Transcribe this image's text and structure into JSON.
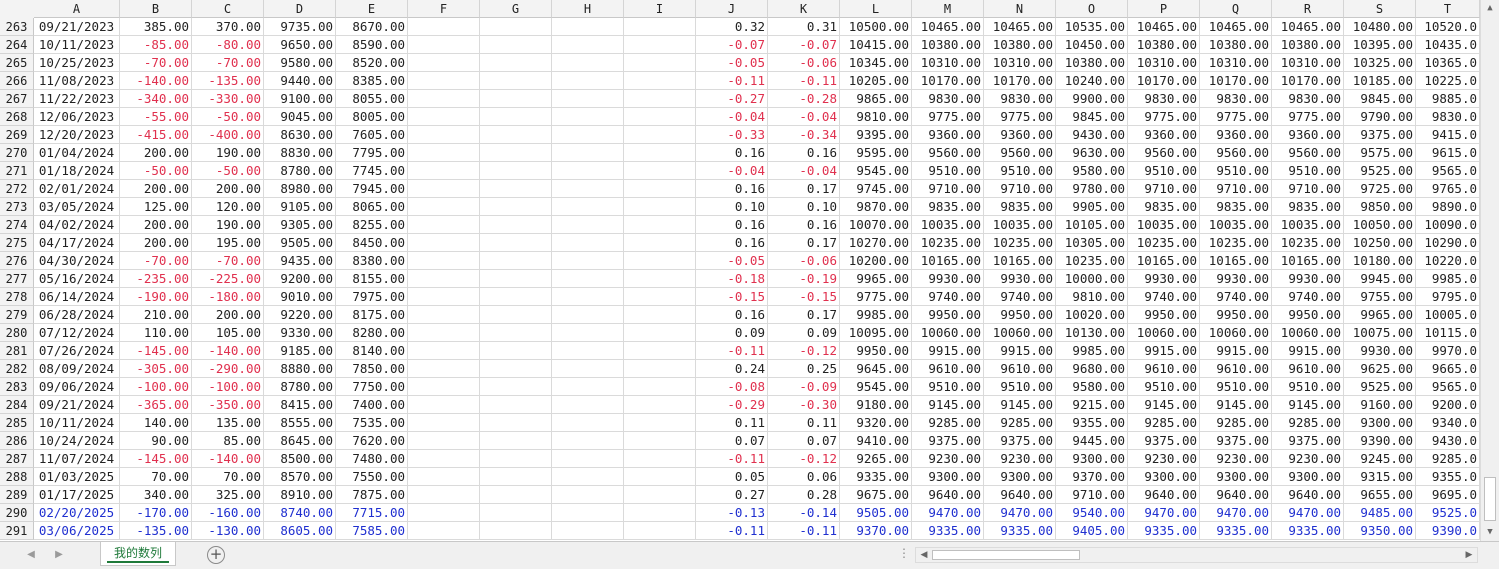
{
  "columns": [
    "A",
    "B",
    "C",
    "D",
    "E",
    "F",
    "G",
    "H",
    "I",
    "J",
    "K",
    "L",
    "M",
    "N",
    "O",
    "P",
    "Q",
    "R",
    "S",
    "T"
  ],
  "rows": [
    {
      "n": "263",
      "c": [
        "09/21/2023",
        "385.00",
        "370.00",
        "9735.00",
        "8670.00",
        "",
        "",
        "",
        "",
        "0.32",
        "0.31",
        "10500.00",
        "10465.00",
        "10465.00",
        "10535.00",
        "10465.00",
        "10465.00",
        "10465.00",
        "10480.00",
        "10520.0"
      ]
    },
    {
      "n": "264",
      "c": [
        "10/11/2023",
        "-85.00",
        "-80.00",
        "9650.00",
        "8590.00",
        "",
        "",
        "",
        "",
        "-0.07",
        "-0.07",
        "10415.00",
        "10380.00",
        "10380.00",
        "10450.00",
        "10380.00",
        "10380.00",
        "10380.00",
        "10395.00",
        "10435.0"
      ]
    },
    {
      "n": "265",
      "c": [
        "10/25/2023",
        "-70.00",
        "-70.00",
        "9580.00",
        "8520.00",
        "",
        "",
        "",
        "",
        "-0.05",
        "-0.06",
        "10345.00",
        "10310.00",
        "10310.00",
        "10380.00",
        "10310.00",
        "10310.00",
        "10310.00",
        "10325.00",
        "10365.0"
      ]
    },
    {
      "n": "266",
      "c": [
        "11/08/2023",
        "-140.00",
        "-135.00",
        "9440.00",
        "8385.00",
        "",
        "",
        "",
        "",
        "-0.11",
        "-0.11",
        "10205.00",
        "10170.00",
        "10170.00",
        "10240.00",
        "10170.00",
        "10170.00",
        "10170.00",
        "10185.00",
        "10225.0"
      ]
    },
    {
      "n": "267",
      "c": [
        "11/22/2023",
        "-340.00",
        "-330.00",
        "9100.00",
        "8055.00",
        "",
        "",
        "",
        "",
        "-0.27",
        "-0.28",
        "9865.00",
        "9830.00",
        "9830.00",
        "9900.00",
        "9830.00",
        "9830.00",
        "9830.00",
        "9845.00",
        "9885.0"
      ]
    },
    {
      "n": "268",
      "c": [
        "12/06/2023",
        "-55.00",
        "-50.00",
        "9045.00",
        "8005.00",
        "",
        "",
        "",
        "",
        "-0.04",
        "-0.04",
        "9810.00",
        "9775.00",
        "9775.00",
        "9845.00",
        "9775.00",
        "9775.00",
        "9775.00",
        "9790.00",
        "9830.0"
      ]
    },
    {
      "n": "269",
      "c": [
        "12/20/2023",
        "-415.00",
        "-400.00",
        "8630.00",
        "7605.00",
        "",
        "",
        "",
        "",
        "-0.33",
        "-0.34",
        "9395.00",
        "9360.00",
        "9360.00",
        "9430.00",
        "9360.00",
        "9360.00",
        "9360.00",
        "9375.00",
        "9415.0"
      ]
    },
    {
      "n": "270",
      "c": [
        "01/04/2024",
        "200.00",
        "190.00",
        "8830.00",
        "7795.00",
        "",
        "",
        "",
        "",
        "0.16",
        "0.16",
        "9595.00",
        "9560.00",
        "9560.00",
        "9630.00",
        "9560.00",
        "9560.00",
        "9560.00",
        "9575.00",
        "9615.0"
      ]
    },
    {
      "n": "271",
      "c": [
        "01/18/2024",
        "-50.00",
        "-50.00",
        "8780.00",
        "7745.00",
        "",
        "",
        "",
        "",
        "-0.04",
        "-0.04",
        "9545.00",
        "9510.00",
        "9510.00",
        "9580.00",
        "9510.00",
        "9510.00",
        "9510.00",
        "9525.00",
        "9565.0"
      ]
    },
    {
      "n": "272",
      "c": [
        "02/01/2024",
        "200.00",
        "200.00",
        "8980.00",
        "7945.00",
        "",
        "",
        "",
        "",
        "0.16",
        "0.17",
        "9745.00",
        "9710.00",
        "9710.00",
        "9780.00",
        "9710.00",
        "9710.00",
        "9710.00",
        "9725.00",
        "9765.0"
      ]
    },
    {
      "n": "273",
      "c": [
        "03/05/2024",
        "125.00",
        "120.00",
        "9105.00",
        "8065.00",
        "",
        "",
        "",
        "",
        "0.10",
        "0.10",
        "9870.00",
        "9835.00",
        "9835.00",
        "9905.00",
        "9835.00",
        "9835.00",
        "9835.00",
        "9850.00",
        "9890.0"
      ]
    },
    {
      "n": "274",
      "c": [
        "04/02/2024",
        "200.00",
        "190.00",
        "9305.00",
        "8255.00",
        "",
        "",
        "",
        "",
        "0.16",
        "0.16",
        "10070.00",
        "10035.00",
        "10035.00",
        "10105.00",
        "10035.00",
        "10035.00",
        "10035.00",
        "10050.00",
        "10090.0"
      ]
    },
    {
      "n": "275",
      "c": [
        "04/17/2024",
        "200.00",
        "195.00",
        "9505.00",
        "8450.00",
        "",
        "",
        "",
        "",
        "0.16",
        "0.17",
        "10270.00",
        "10235.00",
        "10235.00",
        "10305.00",
        "10235.00",
        "10235.00",
        "10235.00",
        "10250.00",
        "10290.0"
      ]
    },
    {
      "n": "276",
      "c": [
        "04/30/2024",
        "-70.00",
        "-70.00",
        "9435.00",
        "8380.00",
        "",
        "",
        "",
        "",
        "-0.05",
        "-0.06",
        "10200.00",
        "10165.00",
        "10165.00",
        "10235.00",
        "10165.00",
        "10165.00",
        "10165.00",
        "10180.00",
        "10220.0"
      ]
    },
    {
      "n": "277",
      "c": [
        "05/16/2024",
        "-235.00",
        "-225.00",
        "9200.00",
        "8155.00",
        "",
        "",
        "",
        "",
        "-0.18",
        "-0.19",
        "9965.00",
        "9930.00",
        "9930.00",
        "10000.00",
        "9930.00",
        "9930.00",
        "9930.00",
        "9945.00",
        "9985.0"
      ]
    },
    {
      "n": "278",
      "c": [
        "06/14/2024",
        "-190.00",
        "-180.00",
        "9010.00",
        "7975.00",
        "",
        "",
        "",
        "",
        "-0.15",
        "-0.15",
        "9775.00",
        "9740.00",
        "9740.00",
        "9810.00",
        "9740.00",
        "9740.00",
        "9740.00",
        "9755.00",
        "9795.0"
      ]
    },
    {
      "n": "279",
      "c": [
        "06/28/2024",
        "210.00",
        "200.00",
        "9220.00",
        "8175.00",
        "",
        "",
        "",
        "",
        "0.16",
        "0.17",
        "9985.00",
        "9950.00",
        "9950.00",
        "10020.00",
        "9950.00",
        "9950.00",
        "9950.00",
        "9965.00",
        "10005.0"
      ]
    },
    {
      "n": "280",
      "c": [
        "07/12/2024",
        "110.00",
        "105.00",
        "9330.00",
        "8280.00",
        "",
        "",
        "",
        "",
        "0.09",
        "0.09",
        "10095.00",
        "10060.00",
        "10060.00",
        "10130.00",
        "10060.00",
        "10060.00",
        "10060.00",
        "10075.00",
        "10115.0"
      ]
    },
    {
      "n": "281",
      "c": [
        "07/26/2024",
        "-145.00",
        "-140.00",
        "9185.00",
        "8140.00",
        "",
        "",
        "",
        "",
        "-0.11",
        "-0.12",
        "9950.00",
        "9915.00",
        "9915.00",
        "9985.00",
        "9915.00",
        "9915.00",
        "9915.00",
        "9930.00",
        "9970.0"
      ]
    },
    {
      "n": "282",
      "c": [
        "08/09/2024",
        "-305.00",
        "-290.00",
        "8880.00",
        "7850.00",
        "",
        "",
        "",
        "",
        "0.24",
        "0.25",
        "9645.00",
        "9610.00",
        "9610.00",
        "9680.00",
        "9610.00",
        "9610.00",
        "9610.00",
        "9625.00",
        "9665.0"
      ]
    },
    {
      "n": "283",
      "c": [
        "09/06/2024",
        "-100.00",
        "-100.00",
        "8780.00",
        "7750.00",
        "",
        "",
        "",
        "",
        "-0.08",
        "-0.09",
        "9545.00",
        "9510.00",
        "9510.00",
        "9580.00",
        "9510.00",
        "9510.00",
        "9510.00",
        "9525.00",
        "9565.0"
      ]
    },
    {
      "n": "284",
      "c": [
        "09/21/2024",
        "-365.00",
        "-350.00",
        "8415.00",
        "7400.00",
        "",
        "",
        "",
        "",
        "-0.29",
        "-0.30",
        "9180.00",
        "9145.00",
        "9145.00",
        "9215.00",
        "9145.00",
        "9145.00",
        "9145.00",
        "9160.00",
        "9200.0"
      ]
    },
    {
      "n": "285",
      "c": [
        "10/11/2024",
        "140.00",
        "135.00",
        "8555.00",
        "7535.00",
        "",
        "",
        "",
        "",
        "0.11",
        "0.11",
        "9320.00",
        "9285.00",
        "9285.00",
        "9355.00",
        "9285.00",
        "9285.00",
        "9285.00",
        "9300.00",
        "9340.0"
      ]
    },
    {
      "n": "286",
      "c": [
        "10/24/2024",
        "90.00",
        "85.00",
        "8645.00",
        "7620.00",
        "",
        "",
        "",
        "",
        "0.07",
        "0.07",
        "9410.00",
        "9375.00",
        "9375.00",
        "9445.00",
        "9375.00",
        "9375.00",
        "9375.00",
        "9390.00",
        "9430.0"
      ]
    },
    {
      "n": "287",
      "c": [
        "11/07/2024",
        "-145.00",
        "-140.00",
        "8500.00",
        "7480.00",
        "",
        "",
        "",
        "",
        "-0.11",
        "-0.12",
        "9265.00",
        "9230.00",
        "9230.00",
        "9300.00",
        "9230.00",
        "9230.00",
        "9230.00",
        "9245.00",
        "9285.0"
      ]
    },
    {
      "n": "288",
      "c": [
        "01/03/2025",
        "70.00",
        "70.00",
        "8570.00",
        "7550.00",
        "",
        "",
        "",
        "",
        "0.05",
        "0.06",
        "9335.00",
        "9300.00",
        "9300.00",
        "9370.00",
        "9300.00",
        "9300.00",
        "9300.00",
        "9315.00",
        "9355.0"
      ]
    },
    {
      "n": "289",
      "c": [
        "01/17/2025",
        "340.00",
        "325.00",
        "8910.00",
        "7875.00",
        "",
        "",
        "",
        "",
        "0.27",
        "0.28",
        "9675.00",
        "9640.00",
        "9640.00",
        "9710.00",
        "9640.00",
        "9640.00",
        "9640.00",
        "9655.00",
        "9695.0"
      ]
    },
    {
      "n": "290",
      "blue": true,
      "c": [
        "02/20/2025",
        "-170.00",
        "-160.00",
        "8740.00",
        "7715.00",
        "",
        "",
        "",
        "",
        "-0.13",
        "-0.14",
        "9505.00",
        "9470.00",
        "9470.00",
        "9540.00",
        "9470.00",
        "9470.00",
        "9470.00",
        "9485.00",
        "9525.0"
      ]
    },
    {
      "n": "291",
      "blue": true,
      "c": [
        "03/06/2025",
        "-135.00",
        "-130.00",
        "8605.00",
        "7585.00",
        "",
        "",
        "",
        "",
        "-0.11",
        "-0.11",
        "9370.00",
        "9335.00",
        "9335.00",
        "9405.00",
        "9335.00",
        "9335.00",
        "9335.00",
        "9350.00",
        "9390.0"
      ]
    }
  ],
  "sheet_tab": "我的数列",
  "add_sheet": "+",
  "nav_prev": "◀",
  "nav_next": "▶",
  "scroll_up": "▲",
  "scroll_down": "▼",
  "scroll_left": "◀",
  "scroll_right": "▶",
  "dots": "⋮",
  "colors": {
    "negative": "#e0304e",
    "highlight": "#1f2fd0",
    "tab": "#1f7a3a"
  }
}
